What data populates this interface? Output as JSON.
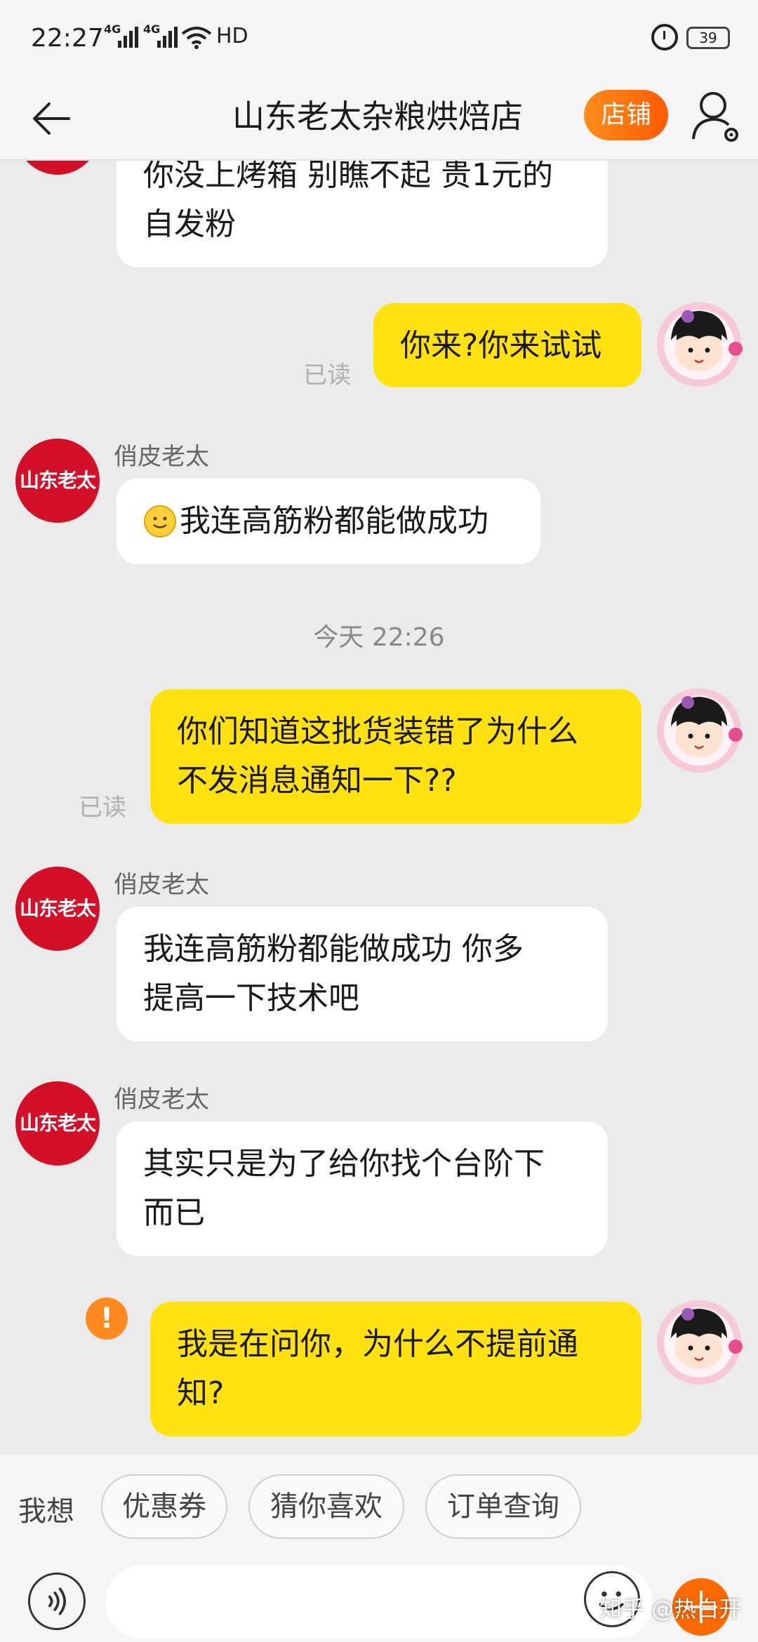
{
  "status_bar": {
    "time": "22:27",
    "signal_1": "4G",
    "signal_2": "4G",
    "hd": "HD",
    "battery": "39",
    "icons": [
      "signal-icon",
      "wifi-icon",
      "alarm-icon",
      "battery-icon"
    ]
  },
  "header": {
    "title": "山东老太杂粮烘焙店",
    "shop_button": "店铺",
    "accent_color": "#ff6a00"
  },
  "shop_avatar_text": "山东老太",
  "messages": {
    "m0": {
      "text_line1": "你没上烤箱 别瞧不起 贵1元的",
      "text_line2": "自发粉"
    },
    "m1": {
      "text": "你来?你来试试",
      "read": "已读"
    },
    "m2": {
      "sender": "俏皮老太",
      "text": "我连高筋粉都能做成功"
    },
    "timestamp": "今天  22:26",
    "m3": {
      "text_line1": "你们知道这批货装错了为什么",
      "text_line2": "不发消息通知一下??",
      "read": "已读"
    },
    "m4": {
      "sender": "俏皮老太",
      "text_line1": "我连高筋粉都能做成功 你多",
      "text_line2": "提高一下技术吧"
    },
    "m5": {
      "sender": "俏皮老太",
      "text_line1": "其实只是为了给你找个台阶下",
      "text_line2": "而已"
    },
    "m6": {
      "text_line1": "我是在问你，为什么不提前通",
      "text_line2": "知?",
      "error_mark": "!"
    }
  },
  "quick_bar": {
    "label": "我想",
    "chips": [
      "优惠券",
      "猜你喜欢",
      "订单查询"
    ]
  },
  "input_bar": {
    "placeholder": ""
  },
  "watermark": "知乎 @热白开",
  "colors": {
    "bubble_out": "#ffe20f",
    "bubble_in": "#ffffff",
    "shop_avatar": "#d31027",
    "error": "#ff8a1f"
  }
}
